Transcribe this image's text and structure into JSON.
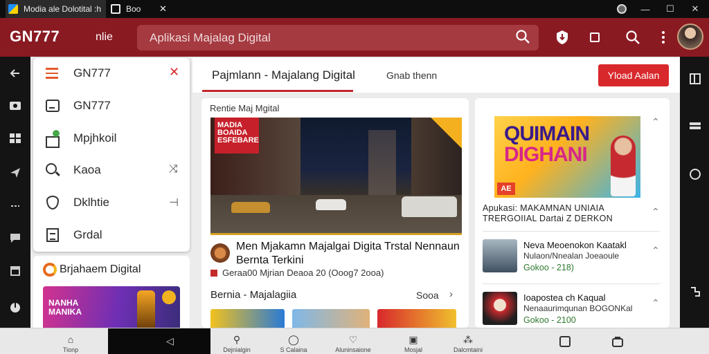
{
  "titlebar": {
    "tab1_label": "Modia ale Dolotital :h",
    "tab2_label": "Boo",
    "tab_close": "✕",
    "min": "—",
    "max": "☐",
    "close": "✕"
  },
  "header": {
    "brand": "GN777",
    "nav_link": "nlie",
    "search_placeholder": "Aplikasi Majalag Digital"
  },
  "drawer": {
    "close_icon": "✕",
    "items": [
      {
        "label": "GN777",
        "icon": "menu-icon",
        "aux": ""
      },
      {
        "label": "GN777",
        "icon": "box-icon",
        "aux": ""
      },
      {
        "label": "Mpjhkoil",
        "icon": "house-icon",
        "aux": ""
      },
      {
        "label": "Kaoa",
        "icon": "search-icon",
        "aux": "⤨"
      },
      {
        "label": "Dklhtie",
        "icon": "shield-icon",
        "aux": "⊣"
      },
      {
        "label": "Grdal",
        "icon": "document-icon",
        "aux": ""
      }
    ]
  },
  "promo": {
    "title": "Brjahaem Digital",
    "image_text": "NANHA\nMANIKA"
  },
  "main_tabs": {
    "active": "Pajmlann  -  Majalang Digital",
    "second": "Gnab thenn",
    "button": "Yload Aalan"
  },
  "article": {
    "section_label": "Rentie Maj Mgital",
    "hero_sign": "MADIA\nBOAIDA\nESFEBARE",
    "title": "Men Mjakamn Majalgai Digita Trstal Nennaun Bernta Terkini",
    "meta": "Geraa00 Mjrian Deaoa 20 (Ooog7 2ooa)",
    "news_heading": "Bernia  -  Majalagiia",
    "news_more": "Sooa",
    "news_chevron": "›"
  },
  "sidebar": {
    "hero_line1": "QUIMAIN",
    "hero_line2": "DIGHANI",
    "hero_tag": "AE",
    "caption": "Apukasi: MAKAMNAN UNIAIA TRERGOIIAL Dartai Z DERKON",
    "chevron_up": "⌃",
    "items": [
      {
        "title": "Neva Meoenokon Kaatakl",
        "subtitle": "Nulaon/Nnealan Joeaoule",
        "price": "Gokoo - 218)"
      },
      {
        "title": "Ioapostea ch Kaqual",
        "subtitle": "Nenaaurimqunan BOGONKal",
        "price": "Gokoo - 2100"
      }
    ]
  },
  "bottomnav": {
    "items": [
      {
        "label": "Tionp",
        "icon": "⌂"
      },
      {
        "label": "Dejnialgin",
        "icon": "⚲"
      },
      {
        "label": "S Calaina",
        "icon": "◯"
      },
      {
        "label": "Aluninsaione",
        "icon": "♡"
      },
      {
        "label": "Mosjal",
        "icon": "▣"
      },
      {
        "label": "Dalcmtaini",
        "icon": "⁂"
      }
    ],
    "back_icon": "◁"
  }
}
